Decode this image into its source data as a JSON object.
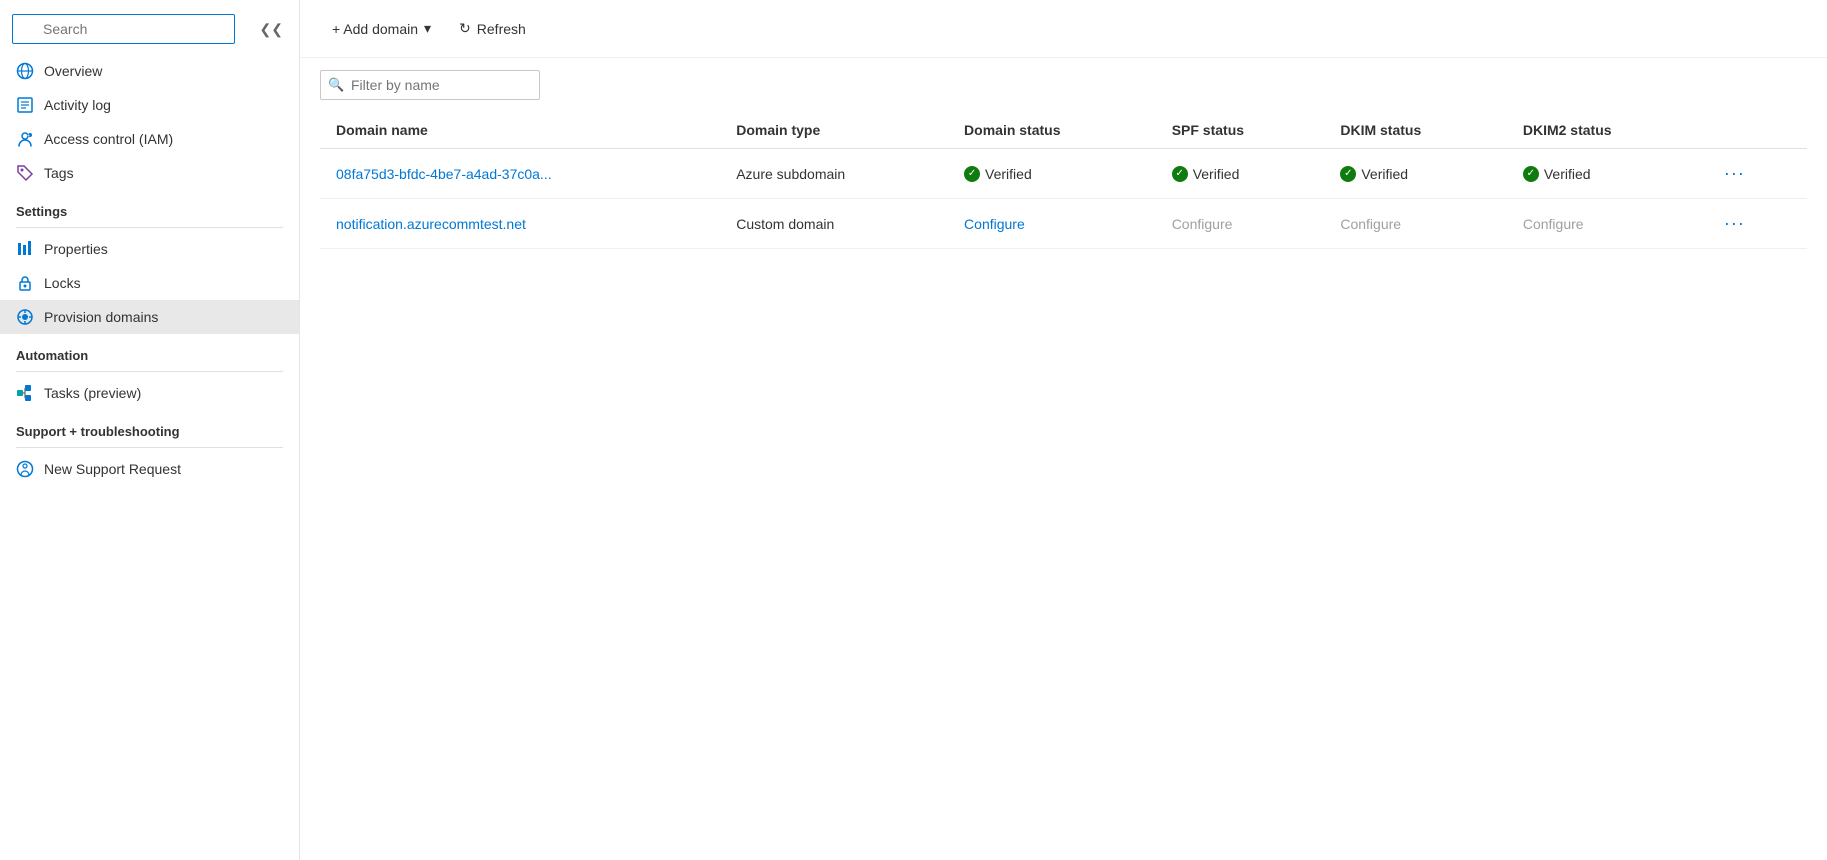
{
  "sidebar": {
    "search_placeholder": "Search",
    "nav_items": [
      {
        "id": "overview",
        "label": "Overview",
        "icon": "globe-icon",
        "active": false
      },
      {
        "id": "activity-log",
        "label": "Activity log",
        "icon": "list-icon",
        "active": false
      },
      {
        "id": "access-control",
        "label": "Access control (IAM)",
        "icon": "person-icon",
        "active": false
      },
      {
        "id": "tags",
        "label": "Tags",
        "icon": "tag-icon",
        "active": false
      }
    ],
    "sections": [
      {
        "header": "Settings",
        "items": [
          {
            "id": "properties",
            "label": "Properties",
            "icon": "bars-icon",
            "active": false
          },
          {
            "id": "locks",
            "label": "Locks",
            "icon": "lock-icon",
            "active": false
          },
          {
            "id": "provision-domains",
            "label": "Provision domains",
            "icon": "provision-icon",
            "active": true
          }
        ]
      },
      {
        "header": "Automation",
        "items": [
          {
            "id": "tasks",
            "label": "Tasks (preview)",
            "icon": "tasks-icon",
            "active": false
          }
        ]
      },
      {
        "header": "Support + troubleshooting",
        "items": [
          {
            "id": "new-support",
            "label": "New Support Request",
            "icon": "support-icon",
            "active": false
          }
        ]
      }
    ]
  },
  "toolbar": {
    "add_domain_label": "+ Add domain",
    "add_domain_dropdown": "▾",
    "refresh_label": "Refresh"
  },
  "filter": {
    "placeholder": "Filter by name"
  },
  "table": {
    "columns": [
      {
        "id": "domain-name",
        "label": "Domain name"
      },
      {
        "id": "domain-type",
        "label": "Domain type"
      },
      {
        "id": "domain-status",
        "label": "Domain status"
      },
      {
        "id": "spf-status",
        "label": "SPF status"
      },
      {
        "id": "dkim-status",
        "label": "DKIM status"
      },
      {
        "id": "dkim2-status",
        "label": "DKIM2 status"
      }
    ],
    "rows": [
      {
        "domain_name": "08fa75d3-bfdc-4be7-a4ad-37c0a...",
        "domain_type": "Azure subdomain",
        "domain_status": "Verified",
        "domain_status_type": "verified",
        "spf_status": "Verified",
        "spf_status_type": "verified",
        "dkim_status": "Verified",
        "dkim_status_type": "verified",
        "dkim2_status": "Verified",
        "dkim2_status_type": "verified"
      },
      {
        "domain_name": "notification.azurecommtest.net",
        "domain_type": "Custom domain",
        "domain_status": "Configure",
        "domain_status_type": "configure-link",
        "spf_status": "Configure",
        "spf_status_type": "configure-text",
        "dkim_status": "Configure",
        "dkim_status_type": "configure-text",
        "dkim2_status": "Configure",
        "dkim2_status_type": "configure-text"
      }
    ]
  }
}
